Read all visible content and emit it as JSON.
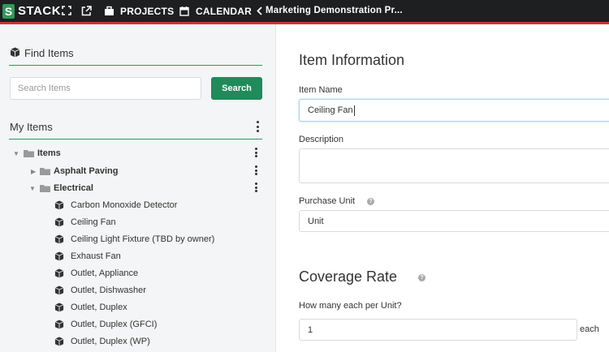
{
  "topbar": {
    "logo_letter": "S",
    "logo_text": "STACK",
    "projects_label": "PROJECTS",
    "calendar_label": "CALENDAR",
    "breadcrumb": "Marketing Demonstration Pr..."
  },
  "sidebar": {
    "find_title": "Find Items",
    "search_placeholder": "Search Items",
    "search_button": "Search",
    "my_items_title": "My Items",
    "tree": {
      "root": "Items",
      "folders": [
        "Asphalt Paving",
        "Electrical"
      ],
      "items": [
        "Carbon Monoxide Detector",
        "Ceiling Fan",
        "Ceiling Light Fixture (TBD by owner)",
        "Exhaust Fan",
        "Outlet, Appliance",
        "Outlet, Dishwasher",
        "Outlet, Duplex",
        "Outlet, Duplex (GFCI)",
        "Outlet, Duplex (WP)"
      ]
    }
  },
  "main": {
    "item_info_title": "Item Information",
    "item_name_label": "Item Name",
    "item_name_value": "Ceiling Fan",
    "description_label": "Description",
    "description_value": "",
    "purchase_unit_label": "Purchase Unit",
    "purchase_unit_value": "Unit",
    "coverage_title": "Coverage Rate",
    "coverage_question": "How many each per Unit?",
    "coverage_value": "1",
    "coverage_suffix": "each"
  },
  "colors": {
    "topbar_bg": "#1d1f21",
    "accent_red": "#c8362f",
    "brand_green": "#1f8a5a"
  }
}
